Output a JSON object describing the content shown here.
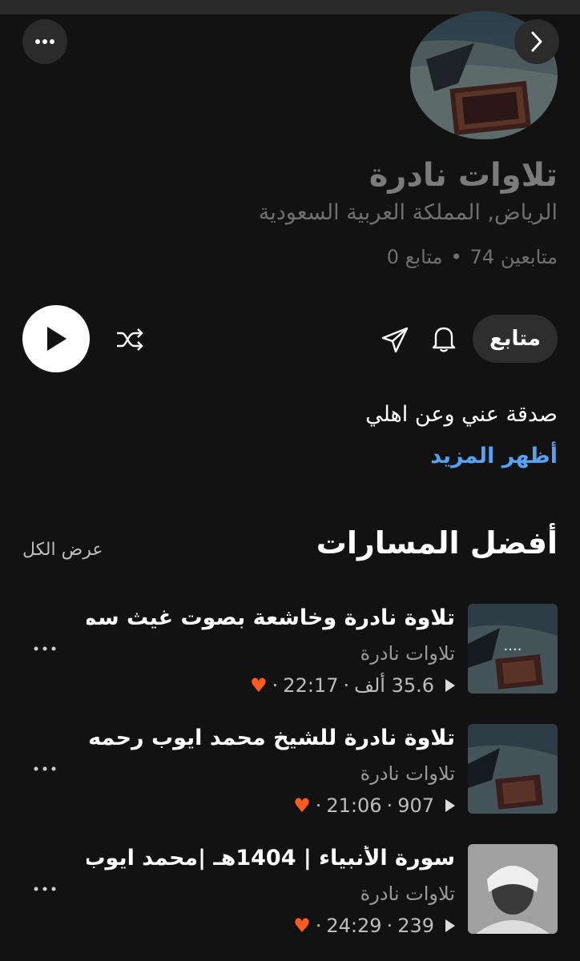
{
  "header": {
    "more_label": "more-options",
    "back_label": "back"
  },
  "profile": {
    "name": "تلاوات نادرة",
    "location": "الرياض, المملكة العربية السعودية",
    "followers": "متابعين 74",
    "following": "متابع 0",
    "separator": "•"
  },
  "actions": {
    "follow_label": "متابع"
  },
  "about": {
    "bio": "صدقة عني وعن اهلي",
    "show_more": "أظهر المزيد"
  },
  "top_tracks": {
    "title": "أفضل المسارات",
    "see_all": "عرض الكل",
    "items": [
      {
        "title": "تلاوة نادرة وخاشعة بصوت غيث سم...",
        "artist": "تلاوات نادرة",
        "plays": "35.6 ألف",
        "duration": "22:17",
        "thumb_text": "....",
        "liked": true
      },
      {
        "title": "تلاوة نادرة للشيخ محمد ايوب رحمه...",
        "artist": "تلاوات نادرة",
        "plays": "907",
        "duration": "21:06",
        "thumb_text": "",
        "liked": true
      },
      {
        "title": "سورة الأنبياء | 1404هـ |محمد ايوب",
        "artist": "تلاوات نادرة",
        "plays": "239",
        "duration": "24:29",
        "thumb_text": "",
        "liked": true
      }
    ]
  },
  "colors": {
    "background": "#121212",
    "link": "#5aa0f0",
    "heart": "#ff5a1f"
  }
}
